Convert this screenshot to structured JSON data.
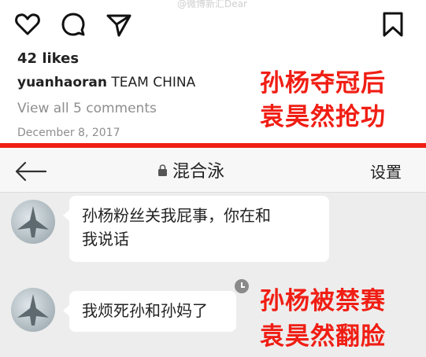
{
  "watermark": "@微博新汇Dear",
  "post": {
    "actions": [
      "heart-icon",
      "comment-icon",
      "share-icon",
      "bookmark-icon"
    ],
    "likes": "42 likes",
    "caption_user": "yuanhaoran",
    "caption_text": "TEAM CHINA",
    "view_comments": "View all 5 comments",
    "date": "December 8, 2017"
  },
  "overlay_top": {
    "line1": "孙杨夺冠后",
    "line2": "袁昊然抢功"
  },
  "chat": {
    "title": "混合泳",
    "settings": "设置",
    "messages": [
      {
        "line1": "孙杨粉丝关我屁事，你在和",
        "line2": "我说话"
      },
      {
        "line1": "我烦死孙和孙妈了"
      }
    ]
  },
  "overlay_bottom": {
    "line1": "孙杨被禁赛",
    "line2": "袁昊然翻脸"
  },
  "colors": {
    "accent_red": "#f01e14",
    "chat_bg": "#ededed",
    "bubble": "#ffffff"
  }
}
